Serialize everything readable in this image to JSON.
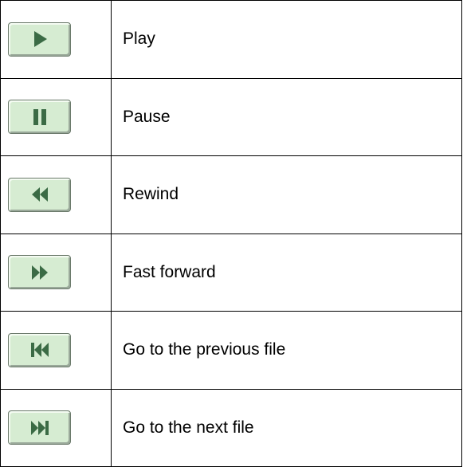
{
  "colors": {
    "button_fill": "#d6ecd2",
    "glyph": "#3b6b45",
    "grid": "#000000"
  },
  "rows": [
    {
      "icon": "play-icon",
      "label": "Play"
    },
    {
      "icon": "pause-icon",
      "label": "Pause"
    },
    {
      "icon": "rewind-icon",
      "label": "Rewind"
    },
    {
      "icon": "fast-forward-icon",
      "label": "Fast forward"
    },
    {
      "icon": "previous-file-icon",
      "label": "Go to the previous file"
    },
    {
      "icon": "next-file-icon",
      "label": "Go to the next file"
    }
  ]
}
